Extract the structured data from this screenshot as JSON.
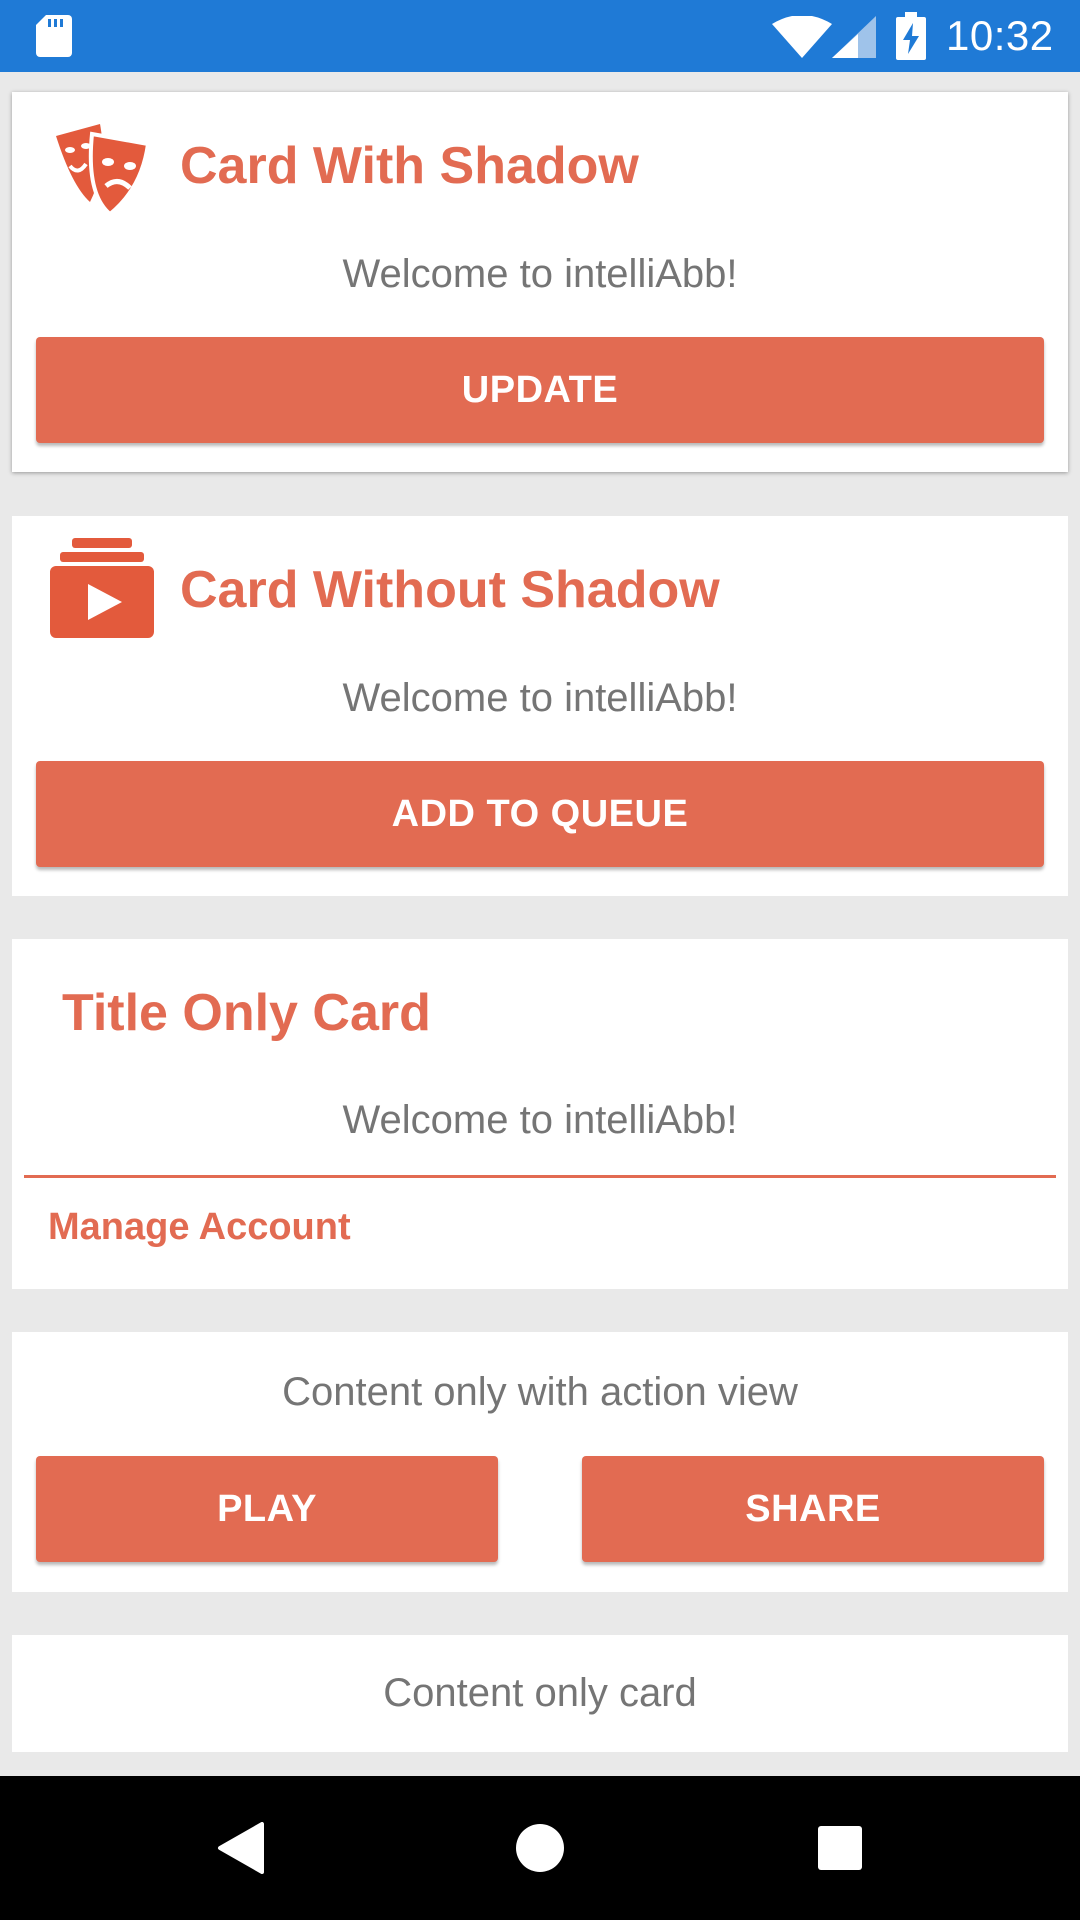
{
  "status_bar": {
    "time": "10:32",
    "icons": [
      "sd-card-icon",
      "wifi-icon",
      "cell-signal-icon",
      "battery-charging-icon"
    ]
  },
  "cards": {
    "shadow_card": {
      "icon": "theater-masks-icon",
      "title": "Card With Shadow",
      "body": "Welcome to intelliAbb!",
      "button": "UPDATE"
    },
    "no_shadow_card": {
      "icon": "video-library-icon",
      "title": "Card Without Shadow",
      "body": "Welcome to intelliAbb!",
      "button": "ADD TO QUEUE"
    },
    "title_only_card": {
      "title": "Title Only Card",
      "body": "Welcome to intelliAbb!",
      "link": "Manage Account"
    },
    "action_card": {
      "body": "Content only with action view",
      "buttons": [
        "PLAY",
        "SHARE"
      ]
    },
    "content_card": {
      "body": "Content only card"
    }
  },
  "nav_bar": {
    "icons": [
      "back-icon",
      "home-icon",
      "recents-icon"
    ]
  },
  "colors": {
    "accent": "#e26b52",
    "status_bar": "#1f7ad6",
    "body_text": "#757575",
    "background": "#e9e9e9"
  }
}
